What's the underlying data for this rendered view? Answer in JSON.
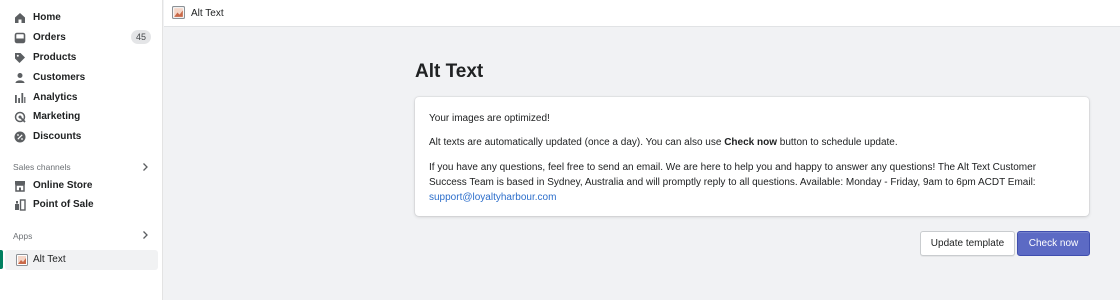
{
  "sidebar": {
    "items": [
      {
        "label": "Home",
        "icon": "home-icon"
      },
      {
        "label": "Orders",
        "icon": "orders-icon",
        "badge": "45"
      },
      {
        "label": "Products",
        "icon": "tag-icon"
      },
      {
        "label": "Customers",
        "icon": "person-icon"
      },
      {
        "label": "Analytics",
        "icon": "bar-chart-icon"
      },
      {
        "label": "Marketing",
        "icon": "marketing-icon"
      },
      {
        "label": "Discounts",
        "icon": "discount-icon"
      }
    ],
    "sales_channels_label": "Sales channels",
    "sales_channels": [
      {
        "label": "Online Store",
        "icon": "store-icon"
      },
      {
        "label": "Point of Sale",
        "icon": "pos-icon"
      }
    ],
    "apps_label": "Apps",
    "apps": [
      {
        "label": "Alt Text",
        "icon": "alt-text-app-icon"
      }
    ]
  },
  "topbar": {
    "app_name": "Alt Text"
  },
  "page": {
    "title": "Alt Text",
    "status_message": "Your images are optimized!",
    "auto_update_text_1": "Alt texts are automatically updated (once a day). You can also use ",
    "auto_update_bold": "Check now",
    "auto_update_text_2": " button to schedule update.",
    "contact_text": "If you have any questions, feel free to send an email. We are here to help you and happy to answer any questions! The Alt Text Customer Success Team is based in Sydney, Australia and will promptly reply to all questions. Available: Monday - Friday, 9am to 6pm ACDT Email:",
    "contact_email": "support@loyaltyharbour.com"
  },
  "actions": {
    "update_template_label": "Update template",
    "check_now_label": "Check now"
  },
  "colors": {
    "primary": "#5c6ac4",
    "active_indicator": "#008060",
    "link": "#2c6ecb"
  }
}
